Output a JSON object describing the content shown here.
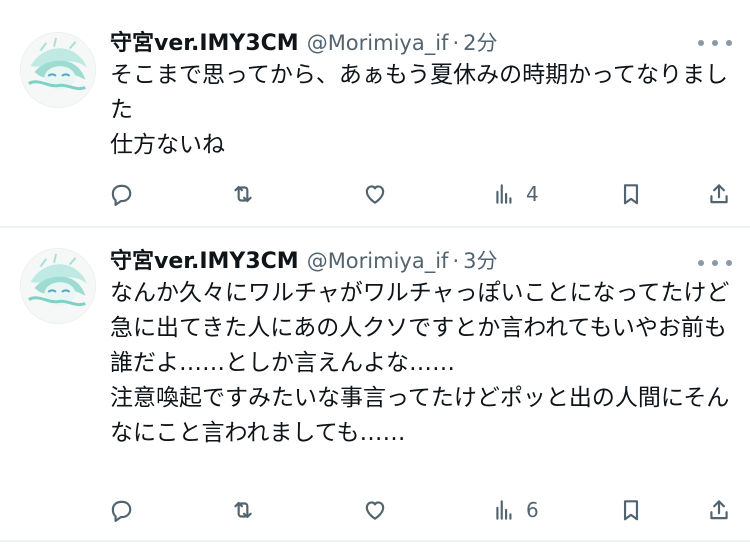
{
  "tweets": [
    {
      "display_name": "守宮ver.IMY3CM",
      "handle": "@Morimiya_if",
      "separator": "·",
      "time": "2分",
      "text": "そこまで思ってから、あぁもう夏休みの時期かってなりました\n仕方ないね",
      "views": "4",
      "icons": [
        "reply-icon",
        "retweet-icon",
        "like-icon",
        "views-icon",
        "bookmark-icon",
        "share-icon",
        "more-icon"
      ]
    },
    {
      "display_name": "守宮ver.IMY3CM",
      "handle": "@Morimiya_if",
      "separator": "·",
      "time": "3分",
      "text": "なんか久々にワルチャがワルチャっぽいことになってたけど\n急に出てきた人にあの人クソですとか言われてもいやお前も誰だよ……としか言えんよな……\n注意喚起ですみたいな事言ってたけどポッと出の人間にそんなにこと言われましても……",
      "views": "6",
      "icons": [
        "reply-icon",
        "retweet-icon",
        "like-icon",
        "views-icon",
        "bookmark-icon",
        "share-icon",
        "more-icon"
      ]
    }
  ],
  "colors": {
    "text": "#0f1419",
    "secondary": "#536471",
    "divider": "#eff3f4",
    "avatar_accent": "#6fd3c7"
  }
}
